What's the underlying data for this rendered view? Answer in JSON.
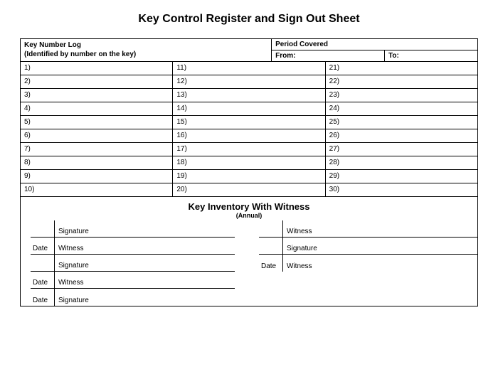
{
  "title": "Key Control Register and Sign Out Sheet",
  "header": {
    "log_title": "Key Number Log",
    "log_sub": "(Identified by number on the key)",
    "period_title": "Period Covered",
    "from_label": "From:",
    "to_label": "To:"
  },
  "log": {
    "col1": [
      "1)",
      "2)",
      "3)",
      "4)",
      "5)",
      "6)",
      "7)",
      "8)",
      "9)",
      "10)"
    ],
    "col2": [
      "11)",
      "12)",
      "13)",
      "14)",
      "15)",
      "16)",
      "17)",
      "18)",
      "19)",
      "20)"
    ],
    "col3": [
      "21)",
      "22)",
      "23)",
      "24)",
      "25)",
      "26)",
      "27)",
      "28)",
      "29)",
      "30)"
    ]
  },
  "inventory": {
    "title": "Key Inventory With Witness",
    "sub": "(Annual)",
    "left_rows": [
      {
        "date": "",
        "label": "Signature"
      },
      {
        "date": "Date",
        "label": "Witness"
      },
      {
        "date": "",
        "label": "Signature"
      },
      {
        "date": "Date",
        "label": "Witness"
      },
      {
        "date": "Date",
        "label": "Signature"
      }
    ],
    "right_rows": [
      {
        "date": "",
        "label": "Witness"
      },
      {
        "date": "",
        "label": "Signature"
      },
      {
        "date": "Date",
        "label": "Witness"
      }
    ]
  }
}
